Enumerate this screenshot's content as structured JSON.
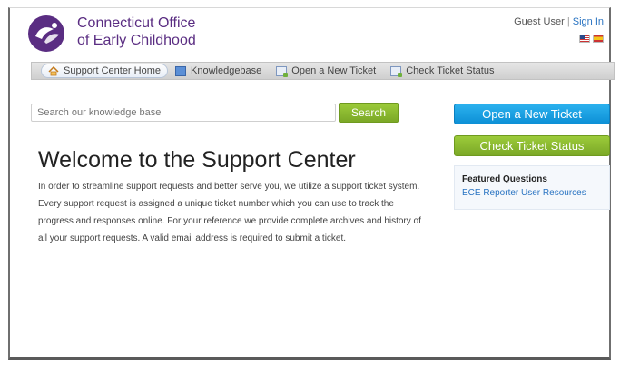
{
  "header": {
    "org_name_line1": "Connecticut Office",
    "org_name_line2": "of Early Childhood",
    "user_label": "Guest User",
    "separator": "|",
    "sign_in": "Sign In",
    "flags": [
      "us-flag-icon",
      "spain-flag-icon"
    ]
  },
  "nav": {
    "items": [
      {
        "label": "Support Center Home",
        "icon": "home-icon",
        "active": true
      },
      {
        "label": "Knowledgebase",
        "icon": "book-icon",
        "active": false
      },
      {
        "label": "Open a New Ticket",
        "icon": "new-ticket-icon",
        "active": false
      },
      {
        "label": "Check Ticket Status",
        "icon": "ticket-status-icon",
        "active": false
      }
    ]
  },
  "search": {
    "placeholder": "Search our knowledge base",
    "button_label": "Search"
  },
  "main": {
    "title": "Welcome to the Support Center",
    "body": "In order to streamline support requests and better serve you, we utilize a support ticket system. Every support request is assigned a unique ticket number which you can use to track the progress and responses online. For your reference we provide complete archives and history of all your support requests. A valid email address is required to submit a ticket."
  },
  "sidebar": {
    "open_ticket_label": "Open a New Ticket",
    "check_status_label": "Check Ticket Status",
    "featured_title": "Featured Questions",
    "featured_link": "ECE Reporter User Resources"
  },
  "colors": {
    "brand_purple": "#5a2d82",
    "button_blue": "#0d90d6",
    "button_green": "#7ba827",
    "link_blue": "#2a74c2"
  }
}
